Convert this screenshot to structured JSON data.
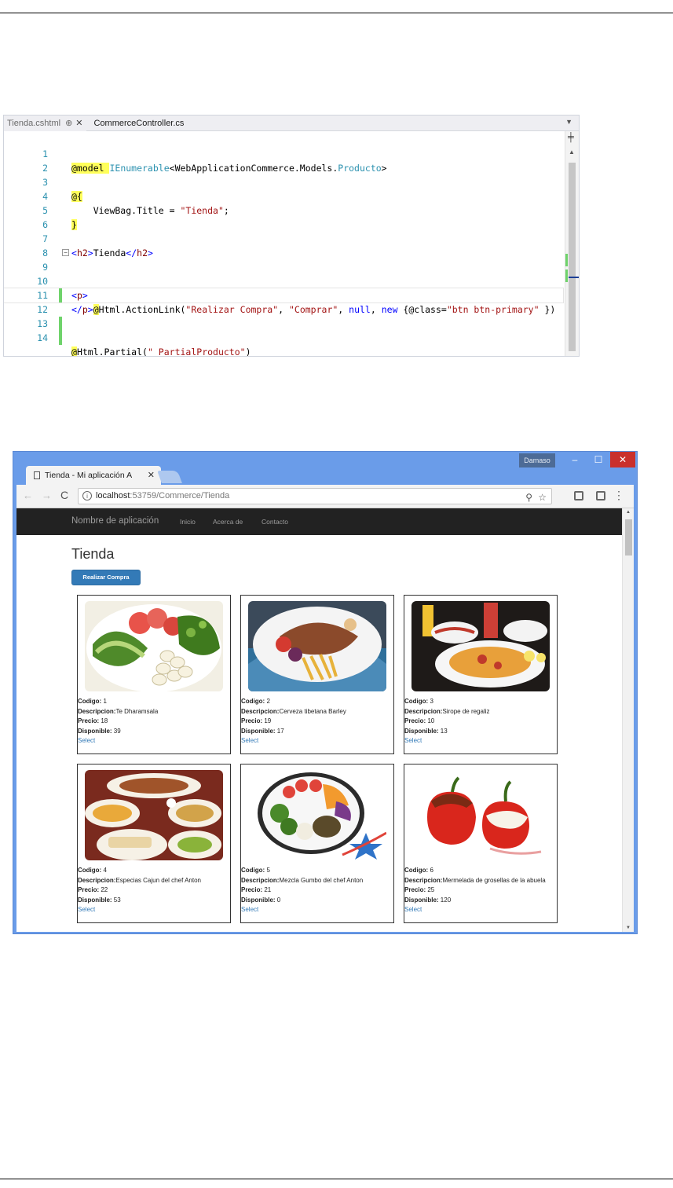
{
  "editor": {
    "tabs": [
      {
        "name": "Tienda.cshtml",
        "pin": "⊕",
        "close": "✕"
      },
      {
        "name": "CommerceController.cs"
      }
    ],
    "line_numbers": [
      "1",
      "2",
      "3",
      "4",
      "5",
      "6",
      "7",
      "8",
      "9",
      "10",
      "11",
      "12",
      "13",
      "14"
    ]
  },
  "browser": {
    "user": "Damaso",
    "tab_title": "Tienda - Mi aplicación A",
    "url_host": "localhost",
    "url_rest": ":53759/Commerce/Tienda",
    "nav": {
      "brand": "Nombre de aplicación",
      "links": [
        "Inicio",
        "Acerca de",
        "Contacto"
      ]
    },
    "page_title": "Tienda",
    "button": "Realizar Compra",
    "labels": {
      "codigo": "Codigo:",
      "descripcion": "Descripcion:",
      "precio": "Precio:",
      "disponible": "Disponible:",
      "select": "Select"
    },
    "products": [
      {
        "codigo": "1",
        "descripcion": "Te Dharamsala",
        "precio": "18",
        "disponible": "39"
      },
      {
        "codigo": "2",
        "descripcion": "Cerveza tibetana Barley",
        "precio": "19",
        "disponible": "17"
      },
      {
        "codigo": "3",
        "descripcion": "Sirope de regaliz",
        "precio": "10",
        "disponible": "13"
      },
      {
        "codigo": "4",
        "descripcion": "Especias Cajun del chef Anton",
        "precio": "22",
        "disponible": "53"
      },
      {
        "codigo": "5",
        "descripcion": "Mezcla Gumbo del chef Anton",
        "precio": "21",
        "disponible": "0"
      },
      {
        "codigo": "6",
        "descripcion": "Mermelada de grosellas de la abuela",
        "precio": "25",
        "disponible": "120"
      }
    ]
  }
}
